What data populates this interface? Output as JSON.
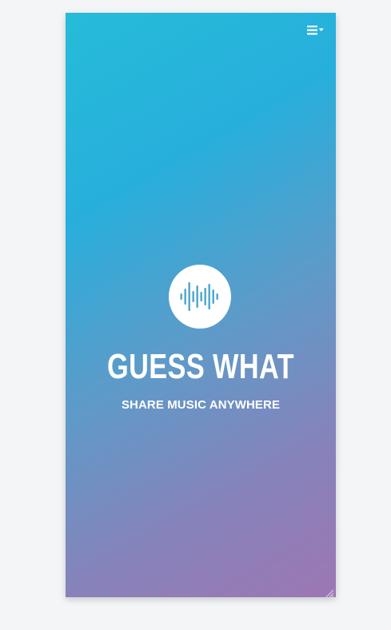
{
  "app": {
    "title": "GUESS WHAT",
    "tagline": "SHARE MUSIC ANYWHERE"
  },
  "header": {
    "menu_icon": "hamburger-dropdown-icon"
  },
  "logo": {
    "icon": "sound-wave-icon"
  },
  "colors": {
    "gradient_start": "#26bcd8",
    "gradient_mid": "#27afdc",
    "gradient_end": "#9d77b3",
    "logo_bars": "#4aa6cf",
    "text": "#ffffff",
    "page_background": "#f4f5f7"
  }
}
